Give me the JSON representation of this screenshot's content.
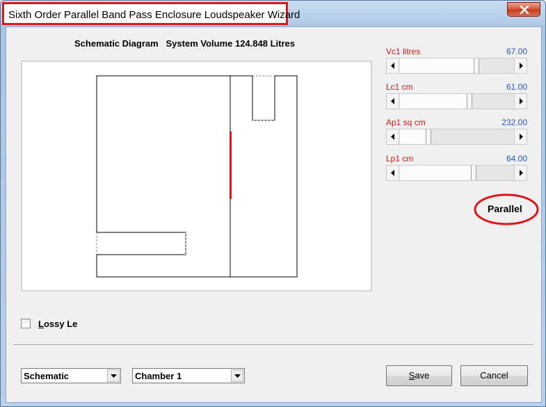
{
  "window": {
    "title": "Sixth Order Parallel Band Pass Enclosure Loudspeaker Wizard"
  },
  "header": {
    "schematic_label": "Schematic Diagram",
    "system_volume": "System Volume 124.848 Litres"
  },
  "parameters": [
    {
      "label": "Vc1  litres",
      "value": "67.00",
      "position_fraction": 0.62
    },
    {
      "label": "Lc1  cm",
      "value": "61.00",
      "position_fraction": 0.58
    },
    {
      "label": "Ap1  sq cm",
      "value": "232.00",
      "position_fraction": 0.22
    },
    {
      "label": "Lp1  cm",
      "value": "64.00",
      "position_fraction": 0.64
    }
  ],
  "mode_label": "Parallel",
  "lossy": {
    "label_underlined": "L",
    "label_rest": "ossy Le",
    "checked": false
  },
  "bottom": {
    "view_select": "Schematic",
    "chamber_select": "Chamber 1",
    "save_underlined": "S",
    "save_rest": "ave",
    "cancel_label": "Cancel"
  },
  "colors": {
    "title_highlight": "#e0161b",
    "param_label": "#cc1b1b",
    "param_value": "#2a56c6",
    "driver": "#e0161b"
  },
  "icons": {
    "close": "close-x-icon",
    "scroll_left": "triangle-left-icon",
    "scroll_right": "triangle-right-icon",
    "dropdown": "triangle-down-icon"
  }
}
